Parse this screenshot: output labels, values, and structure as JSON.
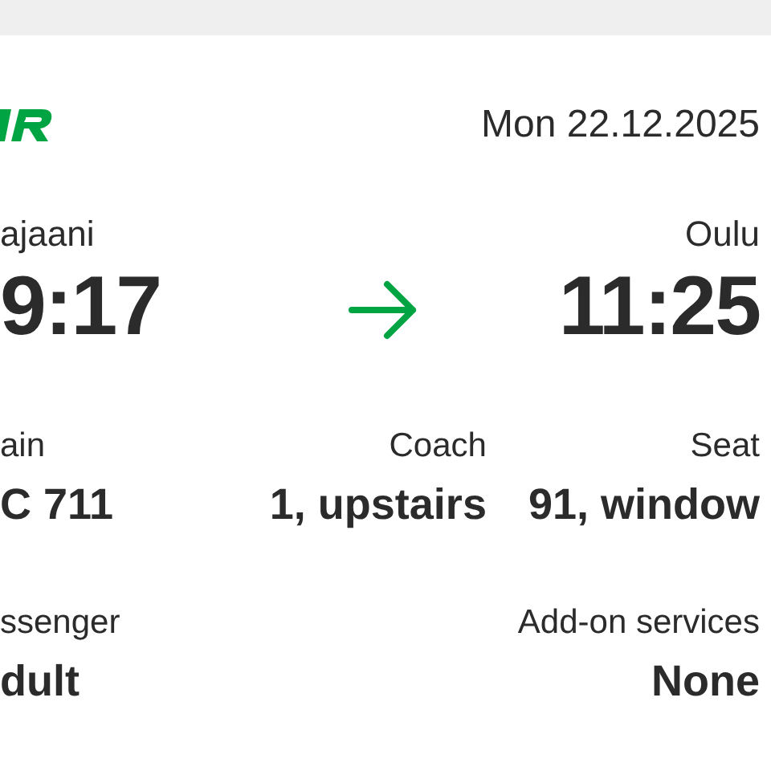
{
  "date": "Mon 22.12.2025",
  "from": {
    "station": "ajaani",
    "time": "9:17"
  },
  "to": {
    "station": "Oulu",
    "time": "11:25"
  },
  "details": [
    {
      "label": "ain",
      "value": "C 711"
    },
    {
      "label": "Coach",
      "value": "1, upstairs"
    },
    {
      "label": "Seat",
      "value": "91, window"
    }
  ],
  "extras": [
    {
      "label": "ssenger",
      "value": "dult"
    },
    {
      "label": "Add-on services",
      "value": "None"
    }
  ]
}
